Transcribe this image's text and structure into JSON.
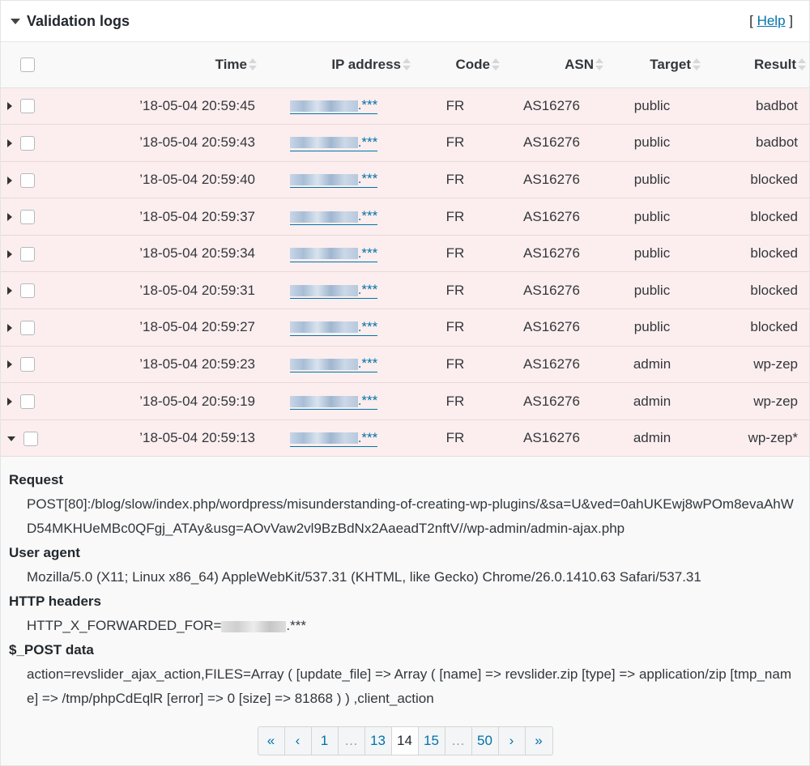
{
  "panel": {
    "title": "Validation logs",
    "help_prefix": "[ ",
    "help_label": "Help",
    "help_suffix": " ]"
  },
  "columns": {
    "time": "Time",
    "ip": "IP address",
    "code": "Code",
    "asn": "ASN",
    "target": "Target",
    "result": "Result"
  },
  "rows": [
    {
      "time": "’18-05-04 20:59:45",
      "ip_suffix": ".***",
      "code": "FR",
      "asn": "AS16276",
      "target": "public",
      "result": "badbot"
    },
    {
      "time": "’18-05-04 20:59:43",
      "ip_suffix": ".***",
      "code": "FR",
      "asn": "AS16276",
      "target": "public",
      "result": "badbot"
    },
    {
      "time": "’18-05-04 20:59:40",
      "ip_suffix": ".***",
      "code": "FR",
      "asn": "AS16276",
      "target": "public",
      "result": "blocked"
    },
    {
      "time": "’18-05-04 20:59:37",
      "ip_suffix": ".***",
      "code": "FR",
      "asn": "AS16276",
      "target": "public",
      "result": "blocked"
    },
    {
      "time": "’18-05-04 20:59:34",
      "ip_suffix": ".***",
      "code": "FR",
      "asn": "AS16276",
      "target": "public",
      "result": "blocked"
    },
    {
      "time": "’18-05-04 20:59:31",
      "ip_suffix": ".***",
      "code": "FR",
      "asn": "AS16276",
      "target": "public",
      "result": "blocked"
    },
    {
      "time": "’18-05-04 20:59:27",
      "ip_suffix": ".***",
      "code": "FR",
      "asn": "AS16276",
      "target": "public",
      "result": "blocked"
    },
    {
      "time": "’18-05-04 20:59:23",
      "ip_suffix": ".***",
      "code": "FR",
      "asn": "AS16276",
      "target": "admin",
      "result": "wp-zep"
    },
    {
      "time": "’18-05-04 20:59:19",
      "ip_suffix": ".***",
      "code": "FR",
      "asn": "AS16276",
      "target": "admin",
      "result": "wp-zep"
    },
    {
      "time": "’18-05-04 20:59:13",
      "ip_suffix": ".***",
      "code": "FR",
      "asn": "AS16276",
      "target": "admin",
      "result": "wp-zep*"
    }
  ],
  "details": {
    "request_label": "Request",
    "request_value": "POST[80]:/blog/slow/index.php/wordpress/misunderstanding-of-creating-wp-plugins/&sa=U&ved=0ahUKEwj8wPOm8evaAhWD54MKHUeMBc0QFgj_ATAy&usg=AOvVaw2vl9BzBdNx2AaeadT2nftV//wp-admin/admin-ajax.php",
    "ua_label": "User agent",
    "ua_value": "Mozilla/5.0 (X11; Linux x86_64) AppleWebKit/537.31 (KHTML, like Gecko) Chrome/26.0.1410.63 Safari/537.31",
    "headers_label": "HTTP headers",
    "headers_prefix": "HTTP_X_FORWARDED_FOR=",
    "headers_suffix": ".***",
    "post_label": "$_POST data",
    "post_value": "action=revslider_ajax_action,FILES=Array ( [update_file] => Array ( [name] => revslider.zip [type] => application/zip [tmp_name] => /tmp/phpCdEqlR [error] => 0 [size] => 81868 ) ) ,client_action"
  },
  "pagination": {
    "first": "«",
    "prev": "‹",
    "p1": "1",
    "gap1": "…",
    "p13": "13",
    "p14": "14",
    "p15": "15",
    "gap2": "…",
    "p50": "50",
    "next": "›",
    "last": "»"
  },
  "colors": {
    "row_bg": "#fceeee",
    "link": "#0073aa"
  }
}
